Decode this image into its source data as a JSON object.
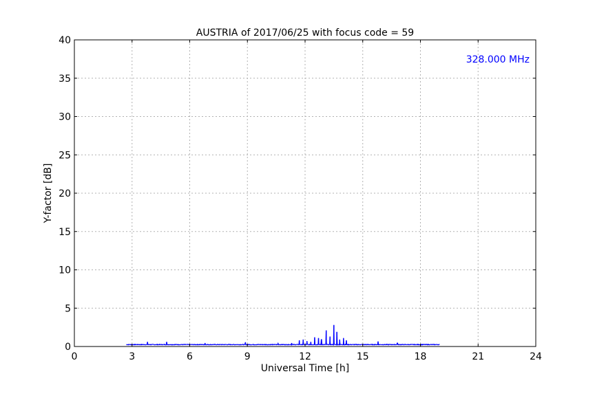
{
  "chart_data": {
    "type": "line",
    "title": "AUSTRIA of 2017/06/25 with focus code = 59",
    "xlabel": "Universal Time [h]",
    "ylabel": "Y-factor [dB]",
    "annotation": "328.000 MHz",
    "xlim": [
      0,
      24
    ],
    "ylim": [
      0,
      40
    ],
    "xticks": [
      0,
      3,
      6,
      9,
      12,
      15,
      18,
      21,
      24
    ],
    "yticks": [
      0,
      5,
      10,
      15,
      20,
      25,
      30,
      35,
      40
    ],
    "grid": true,
    "colors": {
      "line": "#0000ff",
      "annotation": "#0000ff",
      "grid": "#b0b0b0"
    },
    "series": [
      {
        "x_start": 2.7,
        "x_end": 19.0,
        "baseline": 0.25,
        "noise": 0.08,
        "spikes": [
          {
            "x": 3.8,
            "y": 0.6
          },
          {
            "x": 4.8,
            "y": 0.6
          },
          {
            "x": 6.8,
            "y": 0.45
          },
          {
            "x": 8.9,
            "y": 0.55
          },
          {
            "x": 10.6,
            "y": 0.4
          },
          {
            "x": 11.3,
            "y": 0.45
          },
          {
            "x": 11.7,
            "y": 0.8
          },
          {
            "x": 11.9,
            "y": 0.9
          },
          {
            "x": 12.1,
            "y": 0.7
          },
          {
            "x": 12.3,
            "y": 0.6
          },
          {
            "x": 12.5,
            "y": 1.2
          },
          {
            "x": 12.7,
            "y": 1.1
          },
          {
            "x": 12.85,
            "y": 0.9
          },
          {
            "x": 13.1,
            "y": 2.1
          },
          {
            "x": 13.3,
            "y": 1.3
          },
          {
            "x": 13.5,
            "y": 2.8
          },
          {
            "x": 13.65,
            "y": 1.9
          },
          {
            "x": 13.8,
            "y": 0.9
          },
          {
            "x": 14.0,
            "y": 1.1
          },
          {
            "x": 14.15,
            "y": 0.8
          },
          {
            "x": 15.8,
            "y": 0.65
          },
          {
            "x": 16.8,
            "y": 0.45
          }
        ]
      }
    ]
  }
}
